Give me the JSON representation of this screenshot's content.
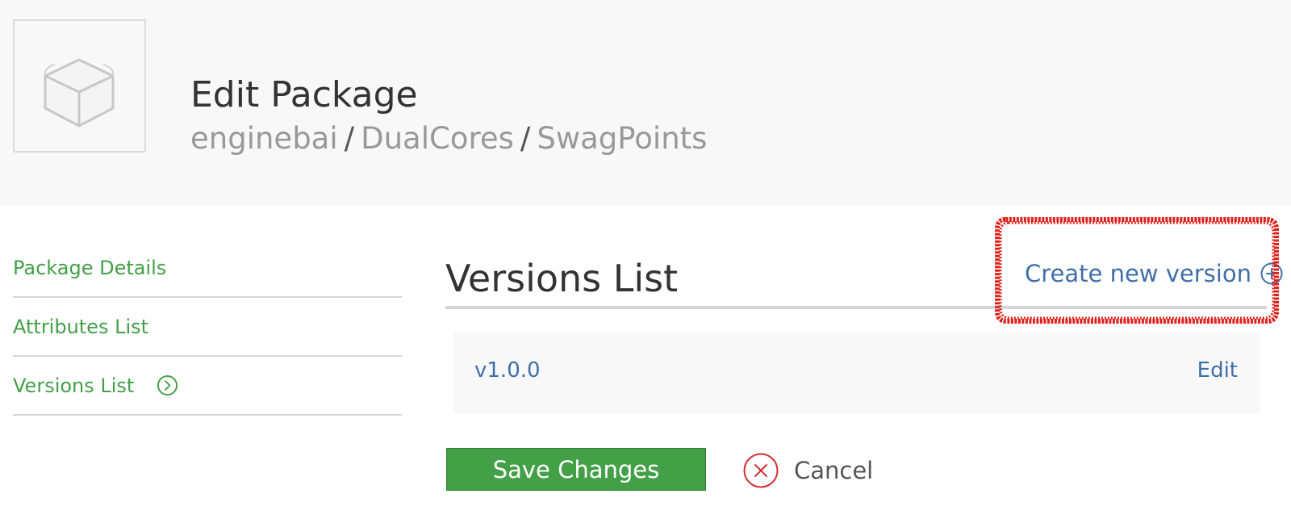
{
  "header": {
    "title": "Edit Package",
    "breadcrumb": [
      "enginebai",
      "DualCores",
      "SwagPoints"
    ],
    "separator": "/",
    "package_icon": "package-box-icon"
  },
  "sidebar": {
    "items": [
      {
        "label": "Package Details"
      },
      {
        "label": "Attributes List"
      },
      {
        "label": "Versions List",
        "icon": "chevron-right-circle-icon"
      }
    ]
  },
  "main": {
    "section_title": "Versions List",
    "create_link": "Create new version",
    "create_icon": "plus-circle-icon",
    "versions": [
      {
        "name": "v1.0.0",
        "edit_label": "Edit"
      }
    ]
  },
  "actions": {
    "save_label": "Save Changes",
    "cancel_label": "Cancel",
    "cancel_icon": "x-circle-icon"
  },
  "colors": {
    "accent_green": "#43a047",
    "link_blue": "#3f6fa8",
    "annotation_red": "#e0201a",
    "header_bg": "#f8f8f8"
  }
}
